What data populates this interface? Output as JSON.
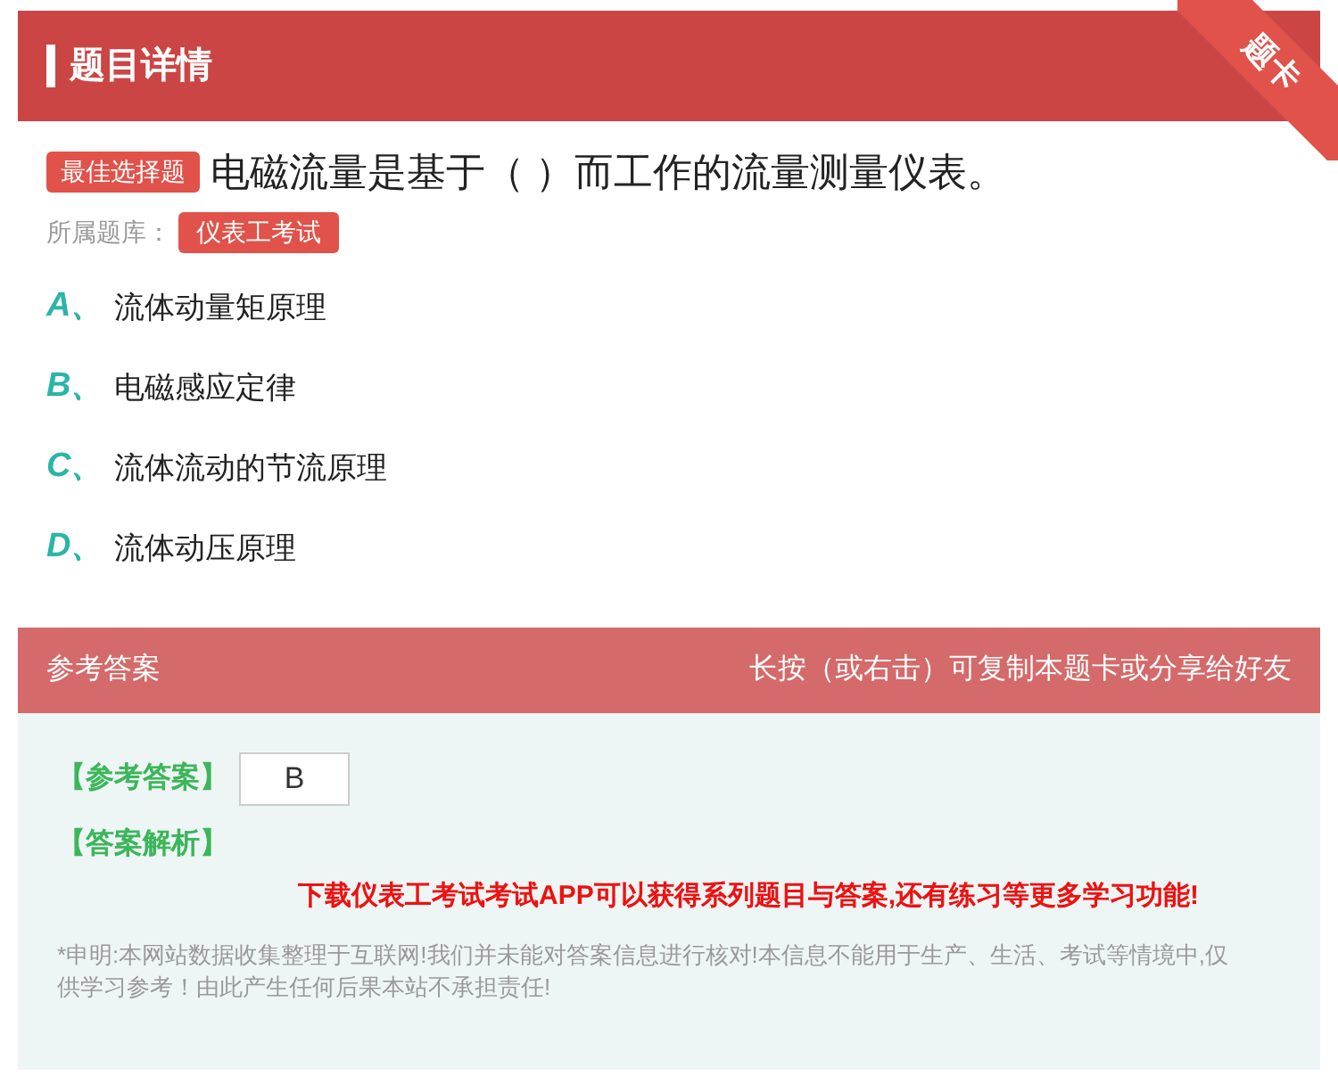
{
  "header": {
    "title": "题目详情",
    "ribbon": "题卡"
  },
  "question": {
    "type_badge": "最佳选择题",
    "text": "电磁流量是基于（ ）而工作的流量测量仪表。",
    "bank_label": "所属题库：",
    "bank": "仪表工考试"
  },
  "options": [
    {
      "letter": "A、",
      "text": "流体动量矩原理"
    },
    {
      "letter": "B、",
      "text": "电磁感应定律"
    },
    {
      "letter": "C、",
      "text": "流体流动的节流原理"
    },
    {
      "letter": "D、",
      "text": "流体动压原理"
    }
  ],
  "answer": {
    "title": "参考答案",
    "hint": "长按（或右击）可复制本题卡或分享给好友",
    "answer_label": "【参考答案】",
    "answer_value": "B",
    "analysis_label": "【答案解析】",
    "promo": "下载仪表工考试考试APP可以获得系列题目与答案,还有练习等更多学习功能!",
    "disclaimer": "*申明:本网站数据收集整理于互联网!我们并未能对答案信息进行核对!本信息不能用于生产、生活、考试等情境中,仅供学习参考！由此产生任何后果本站不承担责任!"
  }
}
